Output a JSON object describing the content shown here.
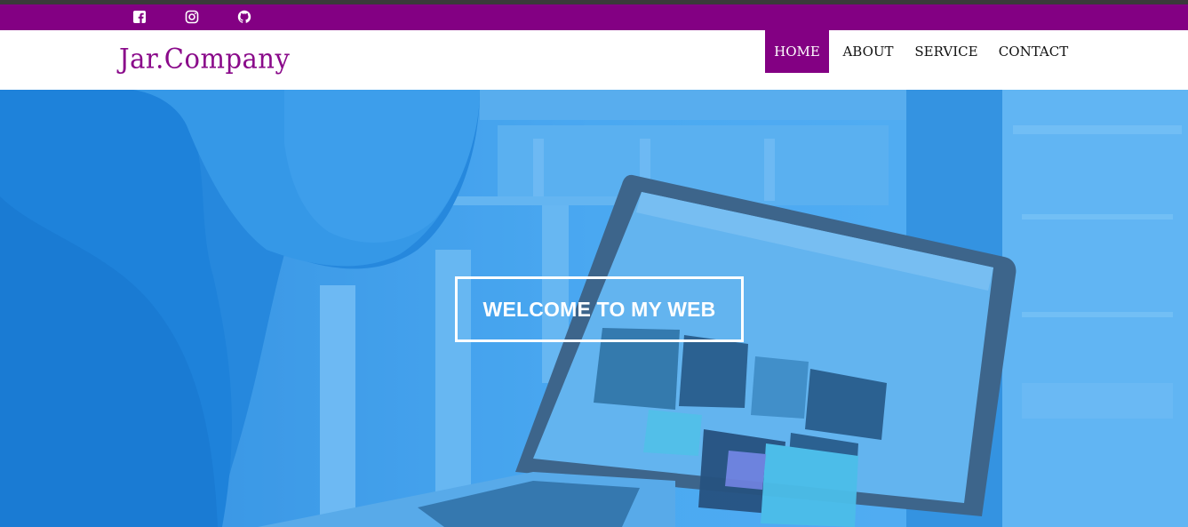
{
  "social": {
    "icons": [
      "facebook-icon",
      "instagram-icon",
      "github-icon"
    ]
  },
  "brand": {
    "name": "Jar.Company",
    "color": "#8a0a8a"
  },
  "nav": {
    "items": [
      {
        "label": "HOME",
        "active": true
      },
      {
        "label": "ABOUT",
        "active": false
      },
      {
        "label": "SERVICE",
        "active": false
      },
      {
        "label": "CONTACT",
        "active": false
      }
    ]
  },
  "hero": {
    "headline": "WELCOME TO MY WEB",
    "overlay_color": "#1e8ef0"
  },
  "colors": {
    "accent": "#830083",
    "header_bg": "#ffffff",
    "hero_text": "#ffffff"
  }
}
